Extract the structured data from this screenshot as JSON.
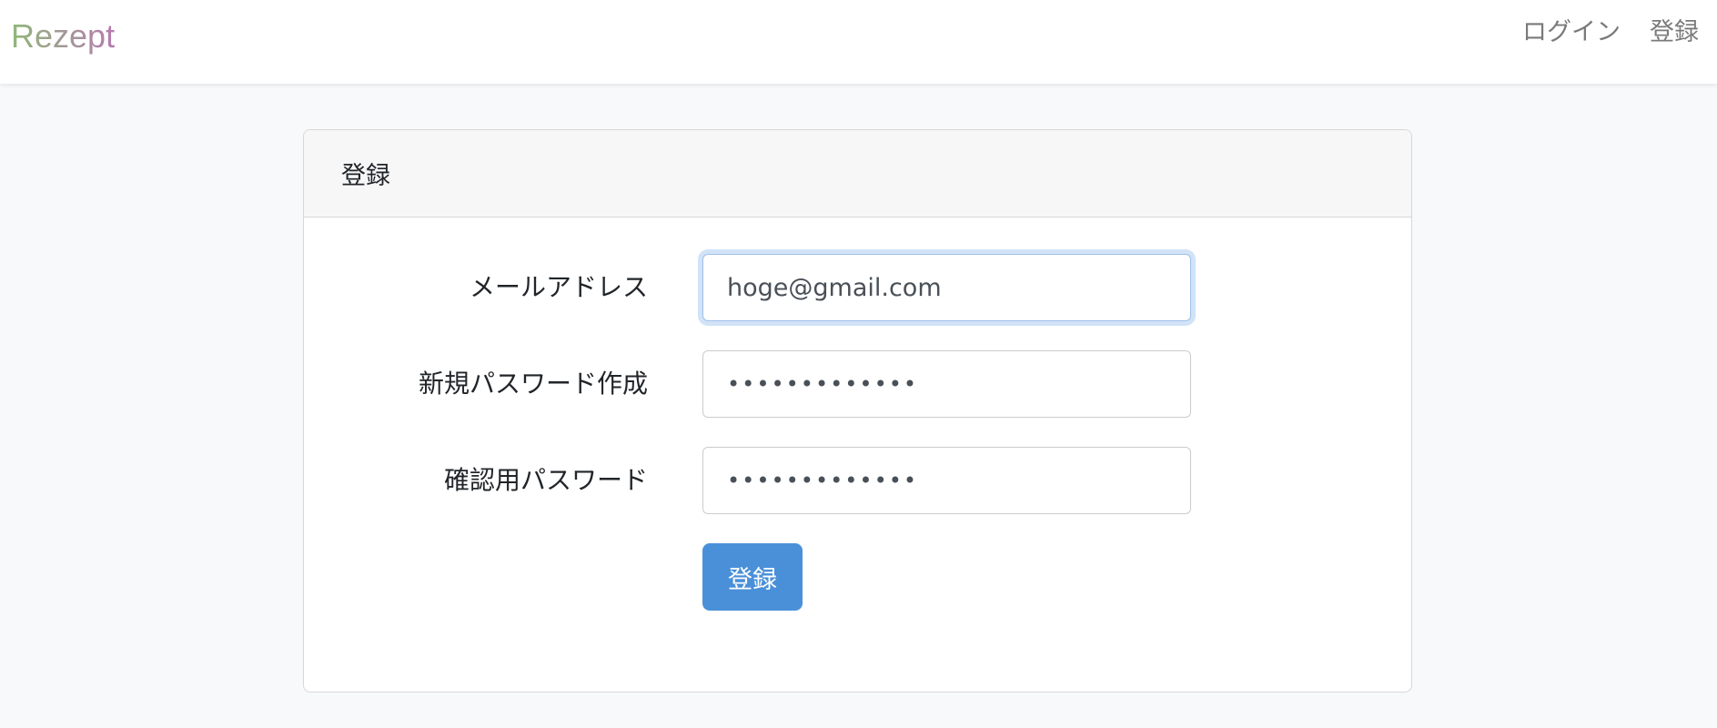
{
  "brand": {
    "name": "Rezept"
  },
  "nav": {
    "login_label": "ログイン",
    "register_label": "登録"
  },
  "card": {
    "title": "登録",
    "fields": {
      "email": {
        "label": "メールアドレス",
        "value": "hoge@gmail.com"
      },
      "new_password": {
        "label": "新規パスワード作成",
        "value": "•••••••••••••"
      },
      "confirm_password": {
        "label": "確認用パスワード",
        "value": "•••••••••••••"
      }
    },
    "submit_label": "登録"
  },
  "colors": {
    "brand_gradient_start": "#8fb87a",
    "brand_gradient_end": "#b77ab0",
    "primary": "#4a90d9",
    "focus_ring": "#9ec0ea",
    "page_background": "#f8f9fa"
  }
}
